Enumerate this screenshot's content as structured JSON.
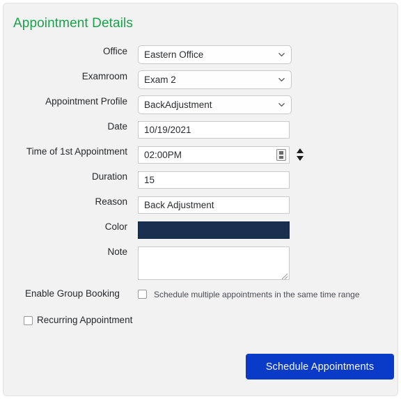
{
  "panel": {
    "title": "Appointment Details",
    "title_color": "#18a24b",
    "background": "#f2f2f2"
  },
  "form": {
    "office": {
      "label": "Office",
      "value": "Eastern Office",
      "type": "select"
    },
    "examroom": {
      "label": "Examroom",
      "value": "Exam 2",
      "type": "select"
    },
    "appointment_profile": {
      "label": "Appointment Profile",
      "value": "BackAdjustment",
      "type": "select"
    },
    "date": {
      "label": "Date",
      "value": "10/19/2021",
      "type": "text"
    },
    "time": {
      "label": "Time of 1st Appointment",
      "value": "02:00PM",
      "type": "text"
    },
    "duration": {
      "label": "Duration",
      "value": "15",
      "type": "text"
    },
    "reason": {
      "label": "Reason",
      "value": "Back Adjustment",
      "type": "text"
    },
    "color": {
      "label": "Color",
      "value": "#1a3050",
      "type": "color"
    },
    "note": {
      "label": "Note",
      "value": "",
      "type": "textarea"
    },
    "group_booking": {
      "label": "Enable Group Booking",
      "description": "Schedule multiple appointments in the same time range",
      "checked": false
    },
    "recurring": {
      "label": "Recurring Appointment",
      "checked": false
    }
  },
  "actions": {
    "submit_label": "Schedule Appointments",
    "submit_color": "#0a3bc8"
  }
}
